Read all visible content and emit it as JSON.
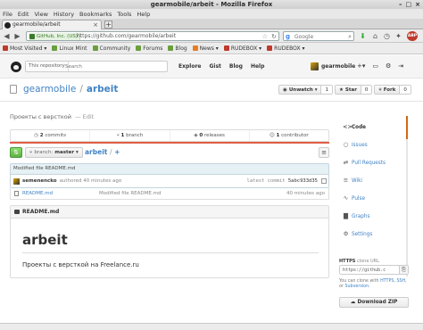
{
  "window": {
    "title": "gearmobile/arbeit - Mozilla Firefox"
  },
  "menubar": [
    "File",
    "Edit",
    "View",
    "History",
    "Bookmarks",
    "Tools",
    "Help"
  ],
  "tab": {
    "label": "gearmobile/arbeit"
  },
  "navbar": {
    "identity": "GitHub, Inc. (US)",
    "url": "https://github.com/gearmobile/arbeit",
    "search_placeholder": "Google"
  },
  "bookmarks": [
    {
      "label": "Most Visited ▾",
      "color": "#c0392b"
    },
    {
      "label": "Linux Mint",
      "color": "#6a9f3c"
    },
    {
      "label": "Community",
      "color": "#6a9f3c"
    },
    {
      "label": "Forums",
      "color": "#6a9f3c"
    },
    {
      "label": "Blog",
      "color": "#6a9f3c"
    },
    {
      "label": "News ▾",
      "color": "#e67e22"
    },
    {
      "label": "RUDEBOX ▾",
      "color": "#c0392b"
    },
    {
      "label": "RUDEBOX ▾",
      "color": "#c0392b"
    }
  ],
  "github": {
    "search_scope": "This repository",
    "search_placeholder": "Search",
    "nav": [
      "Explore",
      "Gist",
      "Blog",
      "Help"
    ],
    "username": "gearmobile"
  },
  "repo": {
    "owner": "gearmobile",
    "name": "arbeit",
    "unwatch": {
      "label": "Unwatch ▾",
      "count": "1"
    },
    "star": {
      "label": "Star",
      "count": "0"
    },
    "fork": {
      "label": "Fork",
      "count": "0"
    },
    "description": "Проекты с версткой",
    "edit_label": "— Edit"
  },
  "numbers": [
    {
      "count": "2",
      "label": "commits"
    },
    {
      "count": "1",
      "label": "branch"
    },
    {
      "count": "0",
      "label": "releases"
    },
    {
      "count": "1",
      "label": "contributor"
    }
  ],
  "branch": {
    "label": "branch:",
    "value": "master ▾"
  },
  "breadcrumb": {
    "repo": "arbeit",
    "sep": "/",
    "add": "+"
  },
  "commit": {
    "message": "Modified file README.md",
    "author": "semenencko",
    "when": "authored 40 minutes ago",
    "latest_label": "latest commit",
    "sha": "5abc933d35"
  },
  "files": [
    {
      "name": "README.md",
      "message": "Modified file README.md",
      "age": "40 minutes ago"
    }
  ],
  "readme": {
    "filename": "README.md",
    "heading": "arbeit",
    "body": "Проекты с версткой на Freelance.ru"
  },
  "sidebar": [
    {
      "label": "Code",
      "icon": "code-icon",
      "glyph": "<>",
      "active": true
    },
    {
      "label": "Issues",
      "icon": "issues-icon",
      "glyph": "○",
      "active": false
    },
    {
      "label": "Pull Requests",
      "icon": "pull-request-icon",
      "glyph": "⇄",
      "active": false
    },
    {
      "label": "Wiki",
      "icon": "wiki-icon",
      "glyph": "≡",
      "active": false
    },
    {
      "label": "Pulse",
      "icon": "pulse-icon",
      "glyph": "∿",
      "active": false
    },
    {
      "label": "Graphs",
      "icon": "graphs-icon",
      "glyph": "▇",
      "active": false
    },
    {
      "label": "Settings",
      "icon": "settings-icon",
      "glyph": "⚙",
      "active": false
    }
  ],
  "clone": {
    "protocol": "HTTPS",
    "suffix": "clone URL",
    "url": "https://github.c",
    "help_prefix": "You can clone with ",
    "https": "HTTPS",
    "ssh": "SSH",
    "or": "or",
    "subversion": "Subversion",
    "download": "Download ZIP"
  },
  "colors": {
    "link": "#4183c4",
    "accent": "#d26911",
    "green": "#60b044",
    "language_bar": "#e05d44"
  }
}
